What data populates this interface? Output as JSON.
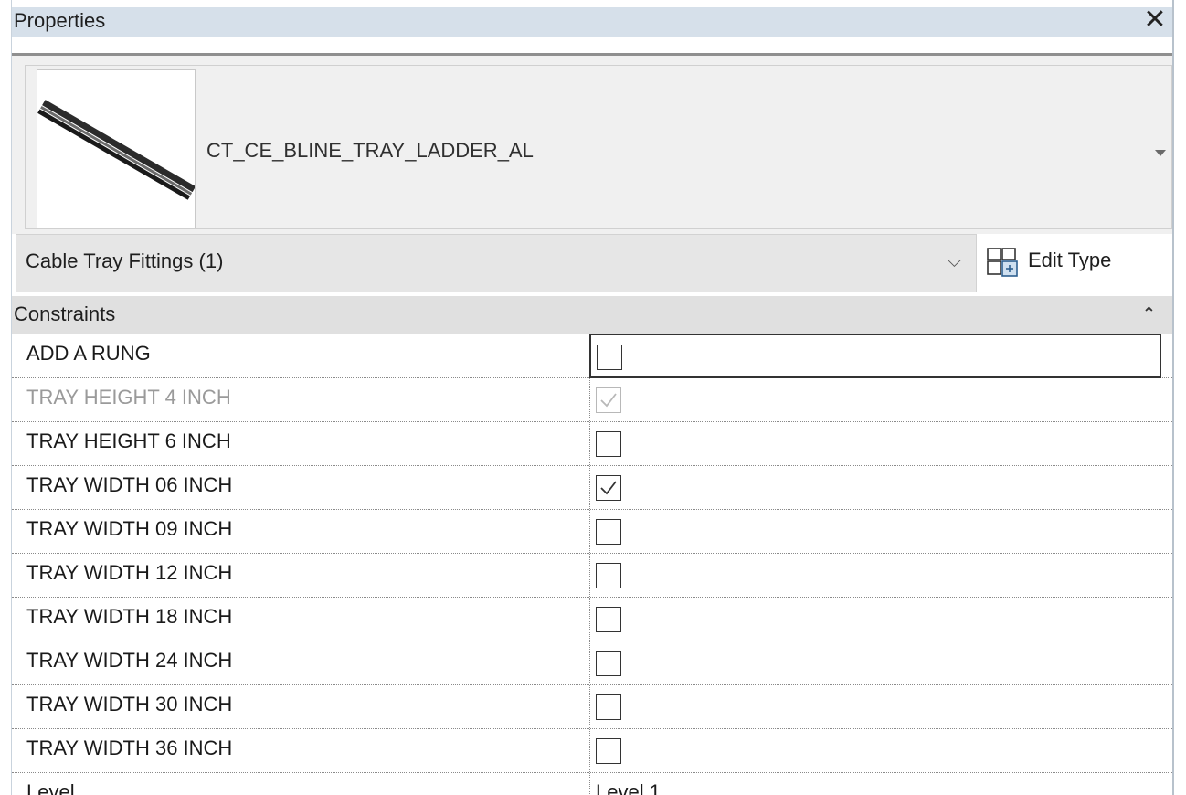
{
  "panel": {
    "title": "Properties",
    "close_glyph": "✕"
  },
  "type_selector": {
    "type_name": "CT_CE_BLINE_TRAY_LADDER_AL",
    "thumbnail_icon": "cable-tray-ladder-thumbnail"
  },
  "filter": {
    "label": "Cable Tray Fittings (1)",
    "chevron_glyph": "⌵",
    "edit_type_label": "Edit Type",
    "edit_type_icon": "edit-type-icon"
  },
  "section": {
    "label": "Constraints",
    "collapse_glyph": "⌃"
  },
  "parameters": [
    {
      "label": "ADD A RUNG",
      "checked": false,
      "enabled": true,
      "selected": true
    },
    {
      "label": "TRAY HEIGHT 4 INCH",
      "checked": true,
      "enabled": false,
      "selected": false
    },
    {
      "label": "TRAY HEIGHT 6 INCH",
      "checked": false,
      "enabled": true,
      "selected": false
    },
    {
      "label": "TRAY WIDTH 06 INCH",
      "checked": true,
      "enabled": true,
      "selected": false
    },
    {
      "label": "TRAY WIDTH 09 INCH",
      "checked": false,
      "enabled": true,
      "selected": false
    },
    {
      "label": "TRAY WIDTH 12 INCH",
      "checked": false,
      "enabled": true,
      "selected": false
    },
    {
      "label": "TRAY WIDTH 18 INCH",
      "checked": false,
      "enabled": true,
      "selected": false
    },
    {
      "label": "TRAY WIDTH 24 INCH",
      "checked": false,
      "enabled": true,
      "selected": false
    },
    {
      "label": "TRAY WIDTH 30 INCH",
      "checked": false,
      "enabled": true,
      "selected": false
    },
    {
      "label": "TRAY WIDTH 36 INCH",
      "checked": false,
      "enabled": true,
      "selected": false
    },
    {
      "label": "Level",
      "value": "Level 1",
      "enabled": true,
      "selected": false
    }
  ]
}
